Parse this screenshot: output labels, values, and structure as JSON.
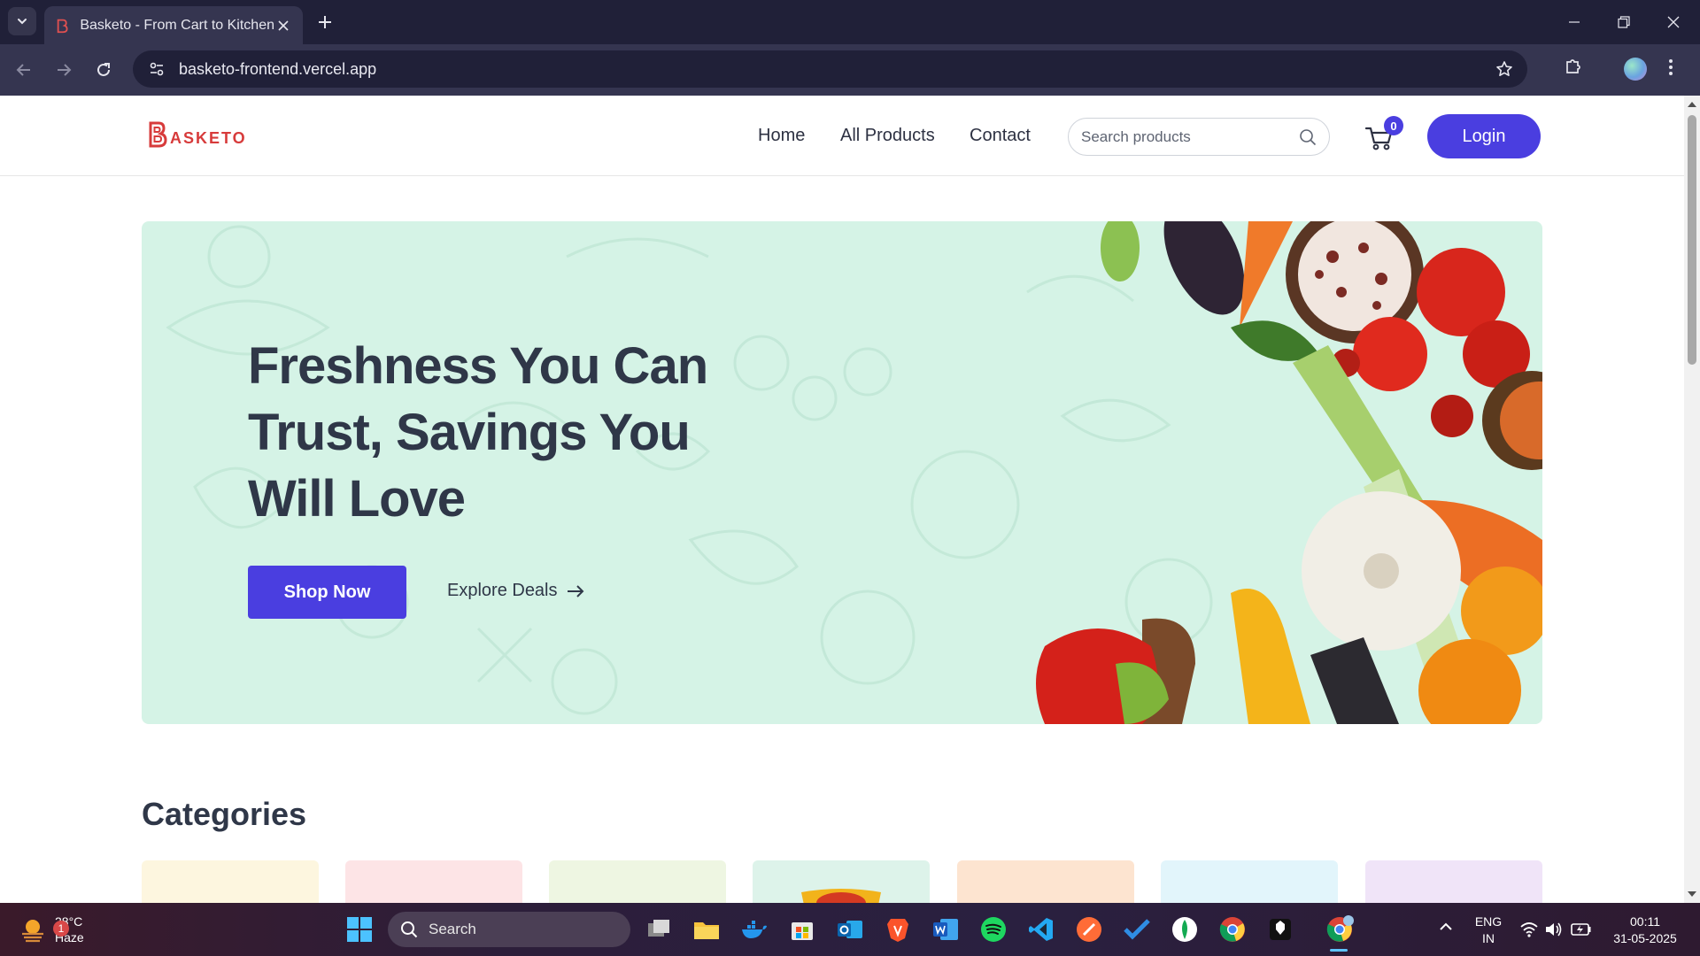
{
  "browser": {
    "tab_title": "Basketo - From Cart to Kitchen",
    "url": "basketo-frontend.vercel.app"
  },
  "site": {
    "logo_text": "ASKETO",
    "nav": [
      "Home",
      "All Products",
      "Contact"
    ],
    "search_placeholder": "Search products",
    "cart_count": "0",
    "login_label": "Login"
  },
  "hero": {
    "title": "Freshness You Can Trust, Savings You Will Love",
    "primary_cta": "Shop Now",
    "secondary_cta": "Explore Deals",
    "background_color": "#d5f3e6"
  },
  "categories": {
    "title": "Categories",
    "card_colors": [
      "#fdf6df",
      "#fde4e6",
      "#eef6e2",
      "#ddf3ea",
      "#fde4d0",
      "#e2f5fb",
      "#f0e4f8"
    ]
  },
  "taskbar": {
    "temperature": "28°C",
    "condition": "Haze",
    "weather_badge": "1",
    "search_label": "Search",
    "lang_top": "ENG",
    "lang_bottom": "IN",
    "time": "00:11",
    "date": "31-05-2025"
  },
  "colors": {
    "accent": "#4a3ee0",
    "brand_red": "#d73b3b"
  }
}
